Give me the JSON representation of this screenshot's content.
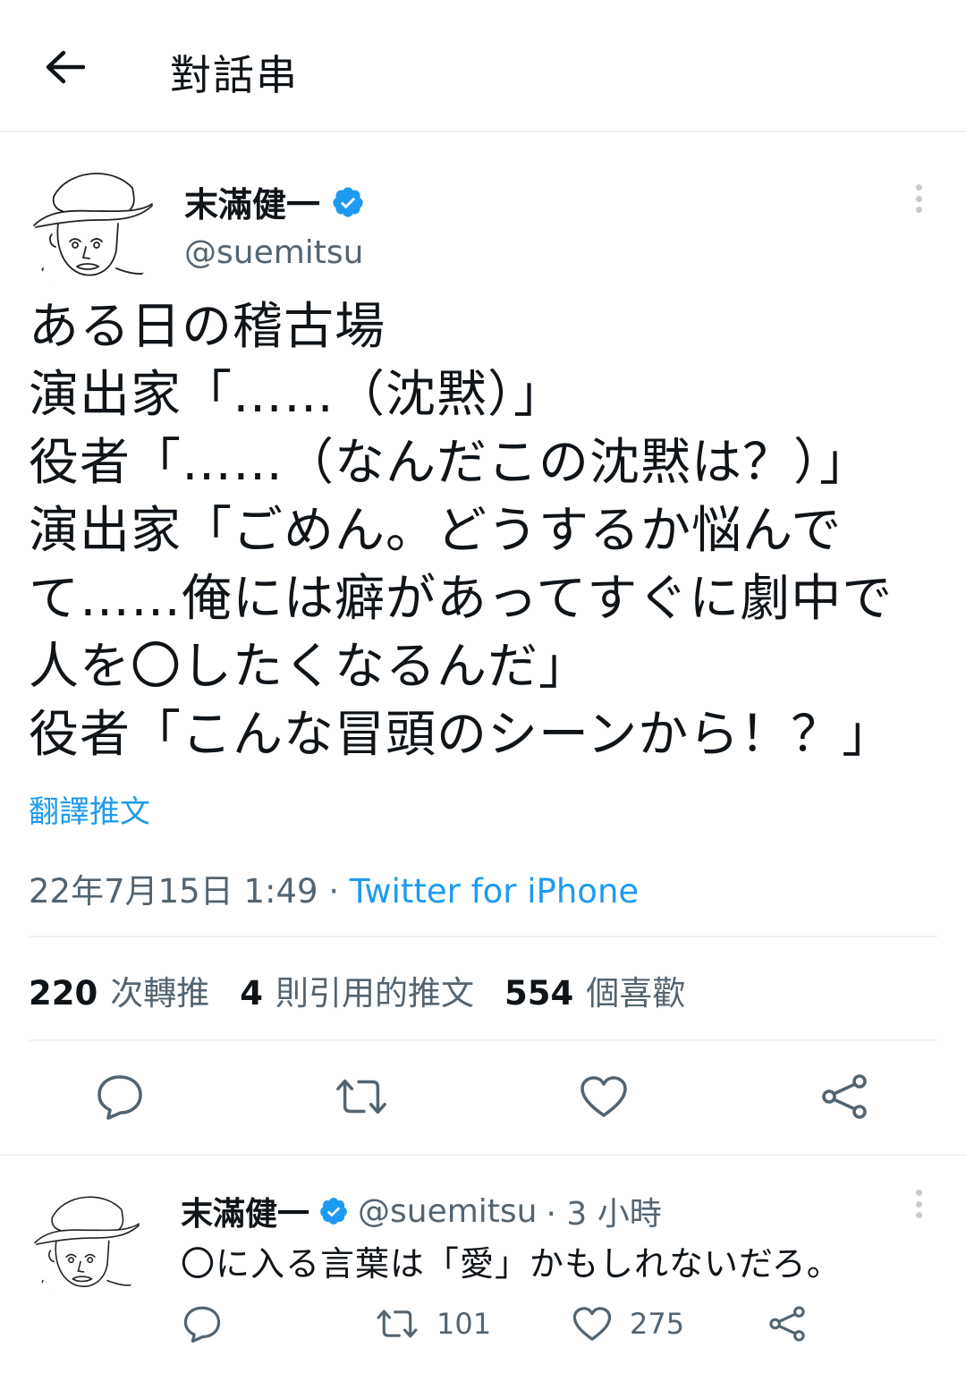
{
  "header": {
    "title": "對話串"
  },
  "tweet": {
    "name": "末滿健一",
    "handle": "@suemitsu",
    "text": "ある日の稽古場\n演出家「……（沈黙）」\n役者「……（なんだこの沈黙は？）」\n演出家「ごめん。どうするか悩んでて……俺には癖があってすぐに劇中で人を〇したくなるんだ」\n役者「こんな冒頭のシーンから！？」",
    "translate": "翻譯推文",
    "timestamp": "22年7月15日 1:49",
    "separator": " · ",
    "source": "Twitter for iPhone",
    "stats": {
      "retweets_num": "220",
      "retweets_label": "次轉推",
      "quotes_num": "4",
      "quotes_label": "則引用的推文",
      "likes_num": "554",
      "likes_label": "個喜歡"
    }
  },
  "reply": {
    "name": "末滿健一",
    "handle": "@suemitsu",
    "time": "· 3 小時",
    "text": "〇に入る言葉は「愛」かもしれないだろ。",
    "retweets": "101",
    "likes": "275"
  },
  "colors": {
    "accent": "#1d9bf0",
    "secondary": "#536471",
    "primary": "#0f1419"
  },
  "icons": [
    "back-arrow-icon",
    "verified-badge-icon",
    "more-icon",
    "reply-icon",
    "retweet-icon",
    "like-icon",
    "share-icon"
  ]
}
